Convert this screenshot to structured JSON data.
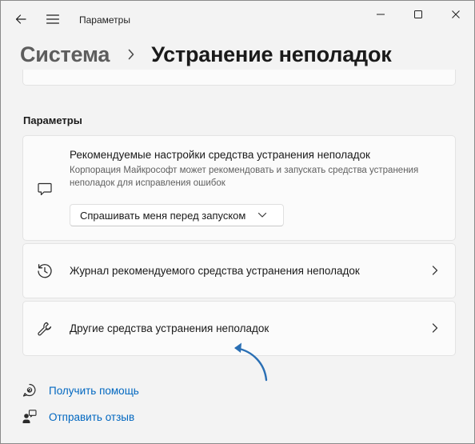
{
  "window": {
    "app_title": "Параметры",
    "icons": {
      "back": "back-arrow-icon",
      "menu": "hamburger-menu-icon",
      "minimize": "minimize-icon",
      "maximize": "maximize-icon",
      "close": "close-icon"
    }
  },
  "breadcrumb": {
    "parent": "Система",
    "current": "Устранение неполадок"
  },
  "section": {
    "heading": "Параметры"
  },
  "recommended": {
    "title": "Рекомендуемые настройки средства устранения неполадок",
    "description": "Корпорация Майкрософт может рекомендовать и запускать средства устранения неполадок для исправления ошибок",
    "dropdown_value": "Спрашивать меня перед запуском",
    "icon": "chat-bubble-icon"
  },
  "history": {
    "label": "Журнал рекомендуемого средства устранения неполадок",
    "icon": "history-icon"
  },
  "other": {
    "label": "Другие средства устранения неполадок",
    "icon": "wrench-icon"
  },
  "links": {
    "help": "Получить помощь",
    "feedback": "Отправить отзыв"
  },
  "colors": {
    "accent": "#0067c0",
    "annotation_arrow": "#2a6fb4",
    "card_background": "#fbfbfb",
    "window_background": "#f3f3f3"
  }
}
